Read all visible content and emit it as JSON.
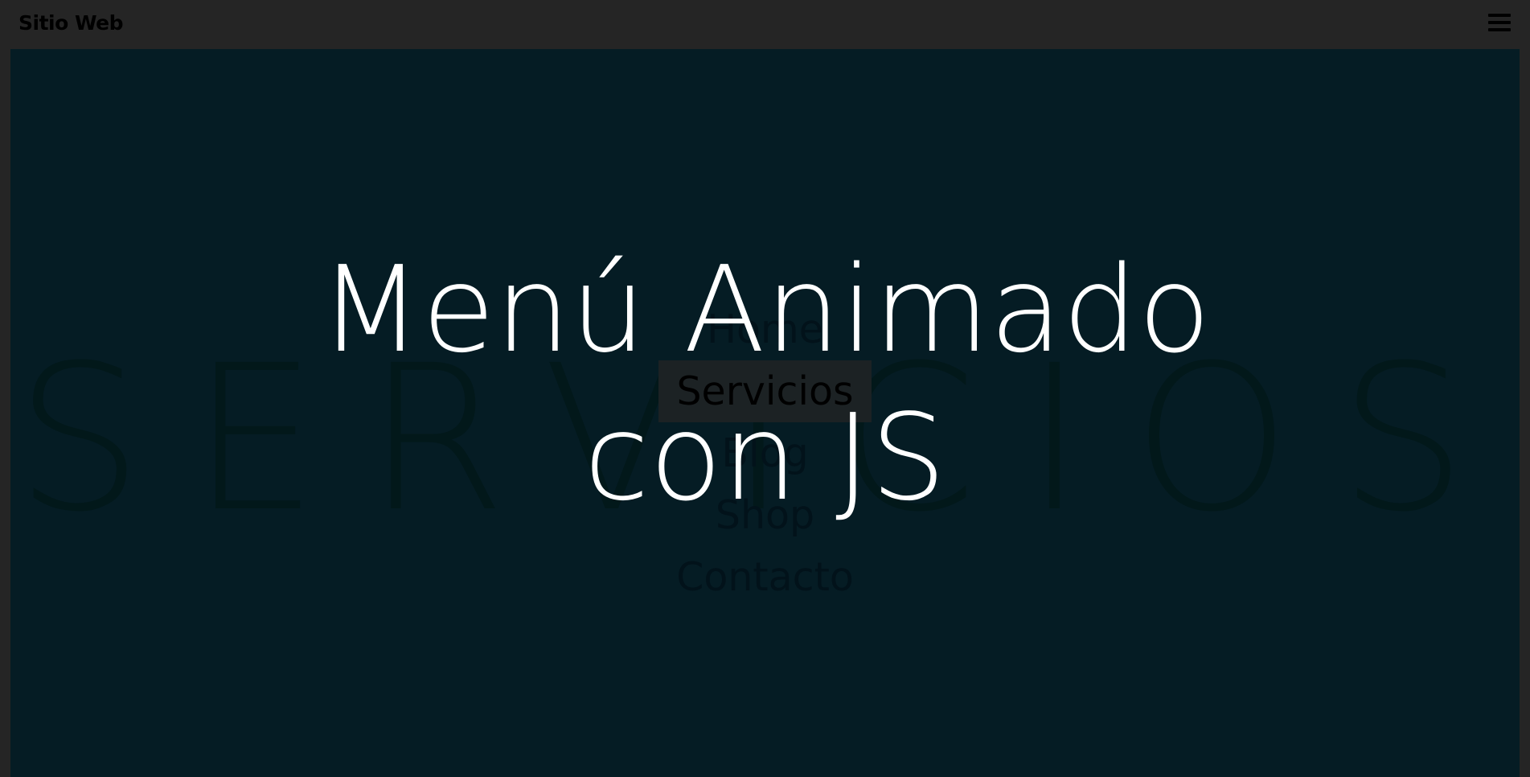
{
  "header": {
    "brand": "Sitio Web",
    "menu_icon": "hamburger-menu-icon"
  },
  "background_word": "SERVICIOS",
  "menu": {
    "items": [
      {
        "label": "Home",
        "active": false
      },
      {
        "label": "Servicios",
        "active": true
      },
      {
        "label": "Blog",
        "active": false
      },
      {
        "label": "Shop",
        "active": false
      },
      {
        "label": "Contacto",
        "active": false
      }
    ]
  },
  "hero": {
    "line1": "Menú Animado",
    "line2": "con JS"
  },
  "colors": {
    "topbar": "#252525",
    "stage": "#051c24",
    "active_item_bg": "#1c2224",
    "title": "#ffffff"
  }
}
